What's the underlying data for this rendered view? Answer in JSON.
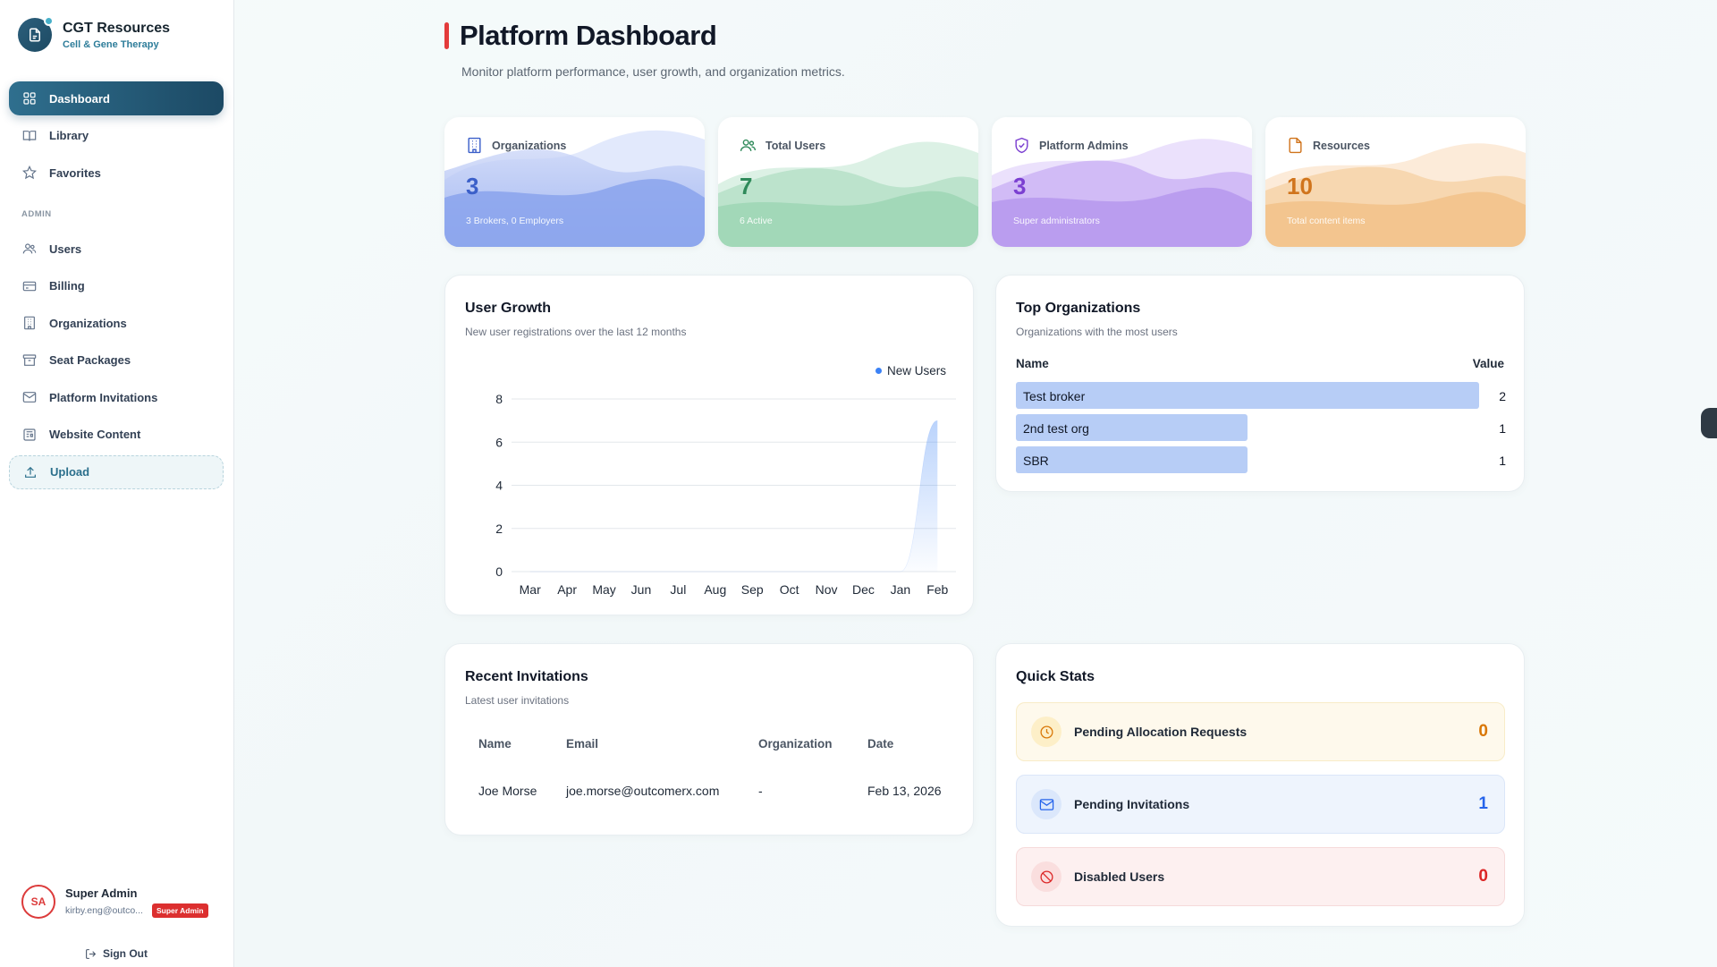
{
  "brand": {
    "title": "CGT Resources",
    "subtitle": "Cell & Gene Therapy"
  },
  "nav": {
    "main": [
      {
        "label": "Dashboard",
        "icon": "grid-icon",
        "active": true
      },
      {
        "label": "Library",
        "icon": "book-icon"
      },
      {
        "label": "Favorites",
        "icon": "star-icon"
      }
    ],
    "section_label": "ADMIN",
    "admin": [
      {
        "label": "Users",
        "icon": "users-icon"
      },
      {
        "label": "Billing",
        "icon": "credit-card-icon"
      },
      {
        "label": "Organizations",
        "icon": "building-icon"
      },
      {
        "label": "Seat Packages",
        "icon": "archive-icon"
      },
      {
        "label": "Platform Invitations",
        "icon": "mail-icon"
      },
      {
        "label": "Website Content",
        "icon": "newspaper-icon"
      },
      {
        "label": "Upload",
        "icon": "upload-icon"
      }
    ]
  },
  "user": {
    "initials": "SA",
    "name": "Super Admin",
    "email": "kirby.eng@outco...",
    "role_badge": "Super Admin",
    "sign_out": "Sign Out"
  },
  "header": {
    "title": "Platform Dashboard",
    "subtitle": "Monitor platform performance, user growth, and organization metrics."
  },
  "stats": [
    {
      "label": "Organizations",
      "value": "3",
      "note": "3 Brokers, 0 Employers",
      "color": "#3b5fc9",
      "icon": "building-icon"
    },
    {
      "label": "Total Users",
      "value": "7",
      "note": "6 Active",
      "color": "#2f8a5a",
      "icon": "users-icon"
    },
    {
      "label": "Platform Admins",
      "value": "3",
      "note": "Super administrators",
      "color": "#7b3fd1",
      "icon": "shield-check-icon"
    },
    {
      "label": "Resources",
      "value": "10",
      "note": "Total content items",
      "color": "#d0741c",
      "icon": "file-icon"
    }
  ],
  "user_growth": {
    "title": "User Growth",
    "subtitle": "New user registrations over the last 12 months",
    "chart_data": {
      "type": "area",
      "categories": [
        "Mar",
        "Apr",
        "May",
        "Jun",
        "Jul",
        "Aug",
        "Sep",
        "Oct",
        "Nov",
        "Dec",
        "Jan",
        "Feb"
      ],
      "series": [
        {
          "name": "New Users",
          "values": [
            0,
            0,
            0,
            0,
            0,
            0,
            0,
            0,
            0,
            0,
            0,
            7
          ]
        }
      ],
      "yticks": [
        "0",
        "2",
        "4",
        "6",
        "8"
      ],
      "ylim": [
        0,
        8
      ],
      "grid": true,
      "legend": "top-right",
      "series_color": "#3b82f6"
    }
  },
  "top_orgs": {
    "title": "Top Organizations",
    "subtitle": "Organizations with the most users",
    "col_name": "Name",
    "col_value": "Value",
    "chart_data": {
      "type": "bar",
      "categories": [
        "Test broker",
        "2nd test org",
        "SBR"
      ],
      "values": [
        2,
        1,
        1
      ],
      "xlim": [
        0,
        2
      ]
    }
  },
  "invitations": {
    "title": "Recent Invitations",
    "subtitle": "Latest user invitations",
    "columns": [
      "Name",
      "Email",
      "Organization",
      "Date"
    ],
    "rows": [
      [
        "Joe Morse",
        "joe.morse@outcomerx.com",
        "-",
        "Feb 13, 2026"
      ]
    ]
  },
  "quick_stats": {
    "title": "Quick Stats",
    "items": [
      {
        "label": "Pending Allocation Requests",
        "value": "0",
        "icon": "clock-icon",
        "color": "#d97706"
      },
      {
        "label": "Pending Invitations",
        "value": "1",
        "icon": "mail-icon",
        "color": "#2563eb"
      },
      {
        "label": "Disabled Users",
        "value": "0",
        "icon": "ban-icon",
        "color": "#dc2626"
      }
    ]
  }
}
